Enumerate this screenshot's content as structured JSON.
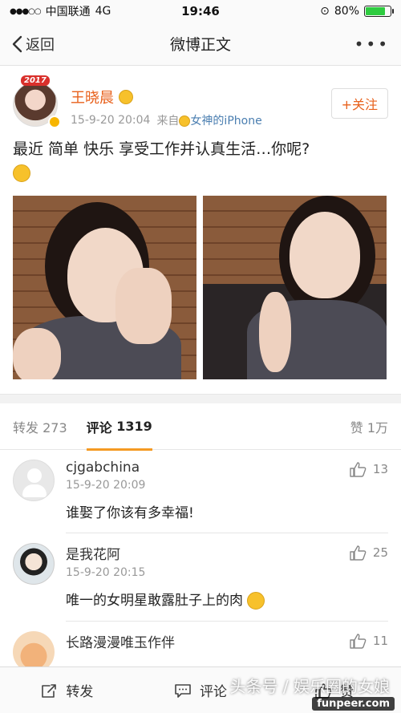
{
  "status_bar": {
    "carrier": "中国联通",
    "network": "4G",
    "time": "19:46",
    "battery_text": "80%",
    "battery_level": 0.8
  },
  "nav": {
    "back_label": "返回",
    "title": "微博正文",
    "more_label": "•••"
  },
  "post": {
    "avatar_badge": "2017",
    "author": "王晓晨",
    "time": "15-9-20 20:04",
    "source_prefix": "来自",
    "source": "女神的iPhone",
    "follow_label": "+关注",
    "text": "最近 简单 快乐 享受工作并认真生活…你呢?"
  },
  "tabs": {
    "repost_label": "转发",
    "repost_count": "273",
    "comments_label": "评论",
    "comments_count": "1319",
    "likes_label": "赞",
    "likes_count": "1万"
  },
  "comments": [
    {
      "name": "cjgabchina",
      "time": "15-9-20 20:09",
      "text": "谁娶了你该有多幸福!",
      "likes": "13"
    },
    {
      "name": "是我花阿",
      "time": "15-9-20 20:15",
      "text": "唯一的女明星敢露肚子上的肉",
      "likes": "25"
    },
    {
      "name": "长路漫漫唯玉作伴",
      "time": "",
      "text": "",
      "likes": "11"
    }
  ],
  "bottom_bar": {
    "repost_label": "转发",
    "comment_label": "评论",
    "like_label": "赞"
  },
  "watermark": {
    "text": "头条号 / 娱乐圈的女娘",
    "site": "funpeer.com"
  },
  "colors": {
    "accent_orange": "#e8611c",
    "tab_underline": "#f59a23",
    "link_blue": "#4a7eb0",
    "battery_green": "#2ecc40"
  }
}
